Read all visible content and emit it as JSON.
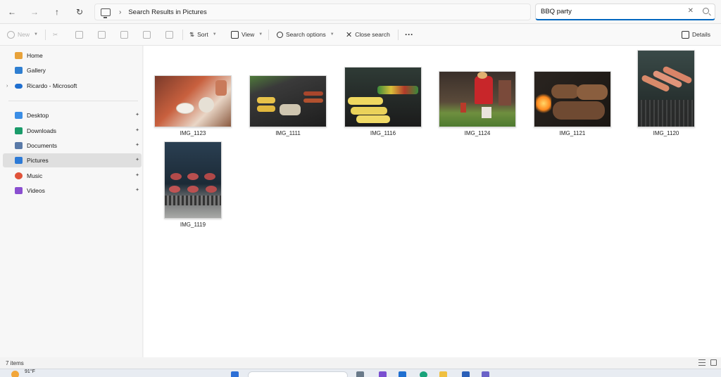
{
  "address_bar": {
    "back_icon": "arrow-left-icon",
    "forward_icon": "arrow-right-icon",
    "up_icon": "arrow-up-icon",
    "refresh_icon": "refresh-icon",
    "back_glyph": "←",
    "forward_glyph": "→",
    "up_glyph": "↑",
    "refresh_glyph": "↻",
    "separator_glyph": "›",
    "location": "Search Results in Pictures",
    "search_value": "BBQ party",
    "clear_glyph": "✕"
  },
  "command_bar": {
    "new_label": "New",
    "sort_label": "Sort",
    "view_label": "View",
    "search_options_label": "Search options",
    "close_search_label": "Close search",
    "more_label": "···",
    "details_label": "Details"
  },
  "sidebar": {
    "items": [
      {
        "label": "Home",
        "icon": "home-icon",
        "color": "#e8a23a"
      },
      {
        "label": "Gallery",
        "icon": "gallery-icon",
        "color": "#2f7fd1"
      },
      {
        "label": "Ricardo - Microsoft",
        "icon": "cloud-icon",
        "color": "#1f6fd0"
      },
      {
        "label": "Desktop",
        "icon": "desktop-icon",
        "color": "#3b8ee6"
      },
      {
        "label": "Downloads",
        "icon": "download-icon",
        "color": "#1a9b6a"
      },
      {
        "label": "Documents",
        "icon": "documents-icon",
        "color": "#5a7aa8"
      },
      {
        "label": "Pictures",
        "icon": "pictures-icon",
        "color": "#2d7ad6"
      },
      {
        "label": "Music",
        "icon": "music-icon",
        "color": "#e0533a"
      },
      {
        "label": "Videos",
        "icon": "videos-icon",
        "color": "#8a4fd0"
      }
    ],
    "pin_glyph": "📌",
    "expand_glyph": "›"
  },
  "files": [
    {
      "name": "IMG_1123"
    },
    {
      "name": "IMG_1111"
    },
    {
      "name": "IMG_1116"
    },
    {
      "name": "IMG_1124"
    },
    {
      "name": "IMG_1121"
    },
    {
      "name": "IMG_1120"
    },
    {
      "name": "IMG_1119"
    }
  ],
  "status_bar": {
    "item_count": "7 items"
  },
  "taskbar": {
    "temperature": "91°F"
  },
  "colors": {
    "accent": "#0067c0",
    "selected_bg": "#dfdfdf"
  }
}
